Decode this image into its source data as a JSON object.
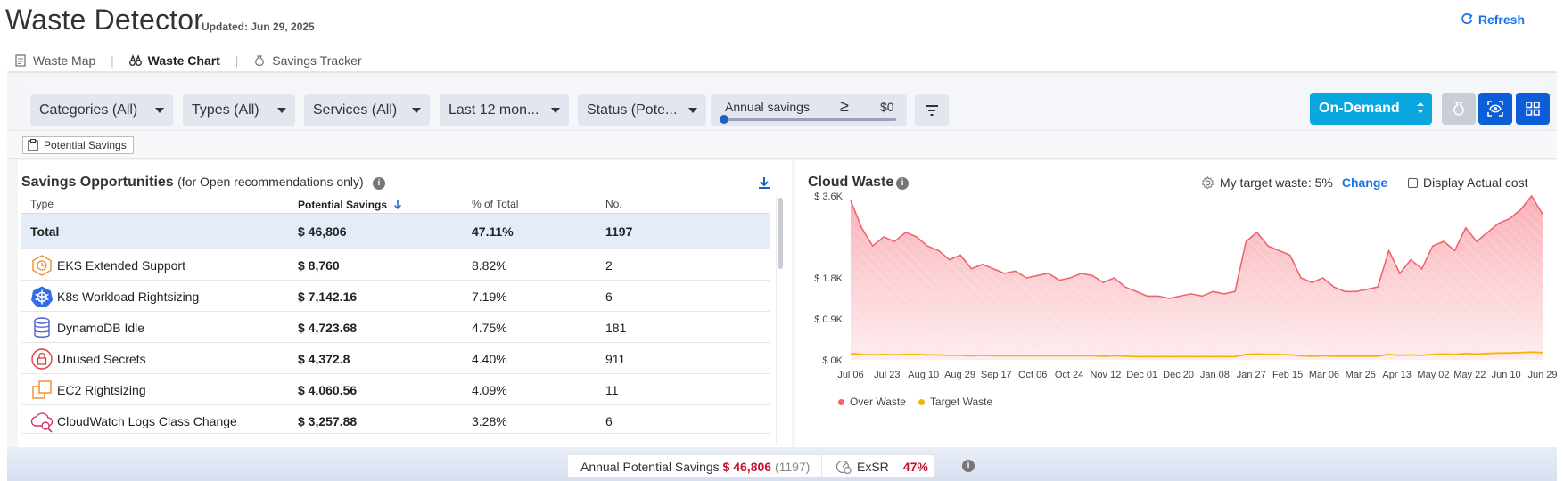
{
  "header": {
    "title": "Waste Detector",
    "updated": "Updated: Jun 29, 2025",
    "refresh_label": "Refresh"
  },
  "tabs": [
    {
      "label": "Waste Map",
      "icon": "document-icon",
      "active": false
    },
    {
      "label": "Waste Chart",
      "icon": "binoculars-icon",
      "active": true
    },
    {
      "label": "Savings Tracker",
      "icon": "money-bag-icon",
      "active": false
    }
  ],
  "filters": {
    "categories": "Categories (All)",
    "types": "Types (All)",
    "services": "Services (All)",
    "period": "Last 12 mon...",
    "status": "Status (Pote...",
    "annual_savings_label": "Annual savings",
    "annual_savings_op": "≥",
    "annual_savings_value": "$0",
    "pricing": "On-Demand"
  },
  "chip": {
    "label": "Potential Savings"
  },
  "opportunities": {
    "title": "Savings Opportunities",
    "subtitle": "(for Open recommendations only)",
    "columns": [
      "Type",
      "Potential Savings",
      "% of Total",
      "No."
    ],
    "total": {
      "label": "Total",
      "savings": "$ 46,806",
      "pct": "47.11%",
      "count": "1197"
    },
    "rows": [
      {
        "type": "EKS Extended Support",
        "savings": "$ 8,760",
        "pct": "8.82%",
        "count": "2",
        "icon": "eks-icon"
      },
      {
        "type": "K8s Workload Rightsizing",
        "savings": "$ 7,142.16",
        "pct": "7.19%",
        "count": "6",
        "icon": "kubernetes-icon"
      },
      {
        "type": "DynamoDB Idle",
        "savings": "$ 4,723.68",
        "pct": "4.75%",
        "count": "181",
        "icon": "dynamodb-icon"
      },
      {
        "type": "Unused Secrets",
        "savings": "$ 4,372.8",
        "pct": "4.40%",
        "count": "911",
        "icon": "secrets-icon"
      },
      {
        "type": "EC2 Rightsizing",
        "savings": "$ 4,060.56",
        "pct": "4.09%",
        "count": "11",
        "icon": "ec2-icon"
      },
      {
        "type": "CloudWatch Logs Class Change",
        "savings": "$ 3,257.88",
        "pct": "3.28%",
        "count": "6",
        "icon": "cloudwatch-icon"
      }
    ]
  },
  "cloud_waste": {
    "title": "Cloud Waste",
    "target_label": "My target waste: 5%",
    "change_label": "Change",
    "display_actual_label": "Display Actual cost"
  },
  "chart_data": {
    "type": "area",
    "title": "Cloud Waste",
    "xlabel": "",
    "ylabel": "",
    "y_ticks": [
      "$ 0K",
      "$ 0.9K",
      "$ 1.8K",
      "$ 3.6K"
    ],
    "x_ticks": [
      "Jul 06",
      "Jul 23",
      "Aug 10",
      "Aug 29",
      "Sep 17",
      "Oct 06",
      "Oct 24",
      "Nov 12",
      "Dec 01",
      "Dec 20",
      "Jan 08",
      "Jan 27",
      "Feb 15",
      "Mar 06",
      "Mar 25",
      "Apr 13",
      "May 02",
      "May 22",
      "Jun 10",
      "Jun 29"
    ],
    "ylim": [
      0,
      3.6
    ],
    "y_unit": "$K",
    "legend_position": "bottom-left",
    "series": [
      {
        "name": "Over Waste",
        "color": "#f2636f",
        "values": [
          3.5,
          2.9,
          2.5,
          2.7,
          2.6,
          2.8,
          2.7,
          2.5,
          2.4,
          2.2,
          2.3,
          2.0,
          2.1,
          2.0,
          1.9,
          1.95,
          1.8,
          1.85,
          1.9,
          1.75,
          1.8,
          1.9,
          1.85,
          1.7,
          1.8,
          1.6,
          1.5,
          1.4,
          1.4,
          1.35,
          1.4,
          1.45,
          1.4,
          1.5,
          1.45,
          1.5,
          2.6,
          2.8,
          2.5,
          2.4,
          2.3,
          1.8,
          1.7,
          1.8,
          1.6,
          1.5,
          1.5,
          1.55,
          1.6,
          2.4,
          1.9,
          2.2,
          2.0,
          2.5,
          2.6,
          2.4,
          2.9,
          2.6,
          2.8,
          3.0,
          3.1,
          3.3,
          3.6,
          3.2
        ]
      },
      {
        "name": "Target Waste",
        "color": "#f2b705",
        "values": [
          0.14,
          0.12,
          0.11,
          0.12,
          0.11,
          0.12,
          0.12,
          0.11,
          0.11,
          0.1,
          0.1,
          0.09,
          0.1,
          0.09,
          0.09,
          0.09,
          0.09,
          0.09,
          0.09,
          0.09,
          0.09,
          0.09,
          0.09,
          0.08,
          0.09,
          0.08,
          0.07,
          0.07,
          0.07,
          0.07,
          0.07,
          0.07,
          0.07,
          0.07,
          0.07,
          0.07,
          0.12,
          0.13,
          0.12,
          0.12,
          0.11,
          0.09,
          0.08,
          0.09,
          0.08,
          0.08,
          0.08,
          0.08,
          0.08,
          0.12,
          0.1,
          0.11,
          0.1,
          0.12,
          0.13,
          0.12,
          0.14,
          0.13,
          0.14,
          0.15,
          0.15,
          0.16,
          0.17,
          0.16
        ]
      }
    ]
  },
  "footer": {
    "annual_label": "Annual Potential Savings",
    "annual_amount": "$ 46,806",
    "annual_count": "(1197)",
    "exsr_label": "ExSR",
    "exsr_value": "47%"
  },
  "colors": {
    "accent": "#1a73e8",
    "ondemand": "#0aa6e0",
    "danger": "#c8102e"
  }
}
